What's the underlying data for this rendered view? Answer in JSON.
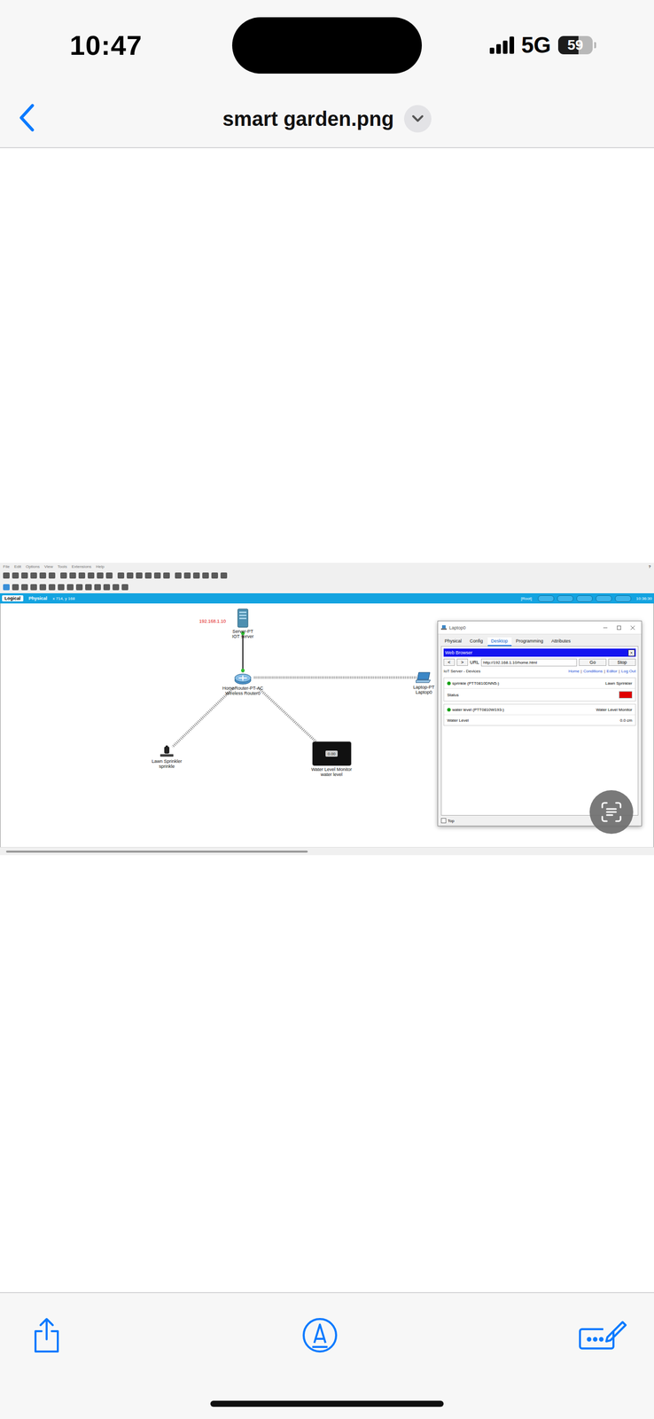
{
  "status_bar": {
    "time": "10:47",
    "network": "5G",
    "battery": "59",
    "battery_level": 0.59
  },
  "viewer": {
    "title": "smart garden.png"
  },
  "pt": {
    "menu": [
      "File",
      "Edit",
      "Options",
      "View",
      "Tools",
      "Extensions",
      "Help"
    ],
    "help": "?",
    "view_tabs": [
      {
        "label": "Logical",
        "selected": true
      },
      {
        "label": "Physical",
        "selected": false
      }
    ],
    "coords": "x 714, y 168",
    "root": "[Root]",
    "clock": "10:36:30",
    "ip_label": "192.168.1.10",
    "nodes": [
      {
        "kind": "server",
        "labels": [
          "Server-PT",
          "IOT server"
        ]
      },
      {
        "kind": "router",
        "labels": [
          "HomeRouter-PT-AC",
          "Wireless Router0"
        ]
      },
      {
        "kind": "laptop",
        "labels": [
          "Laptop-PT",
          "Laptop0"
        ]
      },
      {
        "kind": "sprinkler",
        "labels": [
          "Lawn Sprinkler",
          "sprinkle"
        ]
      },
      {
        "kind": "monitor",
        "labels": [
          "Water Level Monitor",
          "water level"
        ],
        "display": "0.00"
      }
    ],
    "links": [
      {
        "kind": "wired"
      },
      {
        "kind": "wireless"
      },
      {
        "kind": "wireless"
      },
      {
        "kind": "wireless"
      }
    ],
    "scrollbar": {
      "level": 0.47
    },
    "laptop_window": {
      "title": "Laptop0",
      "tabs": [
        {
          "label": "Physical",
          "selected": false
        },
        {
          "label": "Config",
          "selected": false
        },
        {
          "label": "Desktop",
          "selected": true
        },
        {
          "label": "Programming",
          "selected": false
        },
        {
          "label": "Attributes",
          "selected": false
        }
      ],
      "browser": {
        "title": "Web Browser",
        "close": "X",
        "back": "<",
        "forward": ">",
        "url_label": "URL",
        "url": "http://192.168.1.10/home.html",
        "go": "Go",
        "stop": "Stop",
        "page_title": "IoT Server - Devices",
        "nav_links": [
          "Home",
          "Conditions",
          "Editor",
          "Log Out"
        ],
        "separator": "|",
        "devices": [
          {
            "name": "sprinkle (PTT0810DNN5-)",
            "type": "Lawn Sprinkler",
            "online": true,
            "fields": [
              {
                "label": "Status",
                "kind": "indicator",
                "color": "#e00000"
              }
            ]
          },
          {
            "name": "water level (PTT0810W193-)",
            "type": "Water Level Monitor",
            "online": true,
            "fields": [
              {
                "label": "Water Level",
                "kind": "text",
                "value": "0.0 cm"
              }
            ]
          }
        ]
      },
      "top": {
        "label": "Top",
        "checked": false
      }
    }
  }
}
